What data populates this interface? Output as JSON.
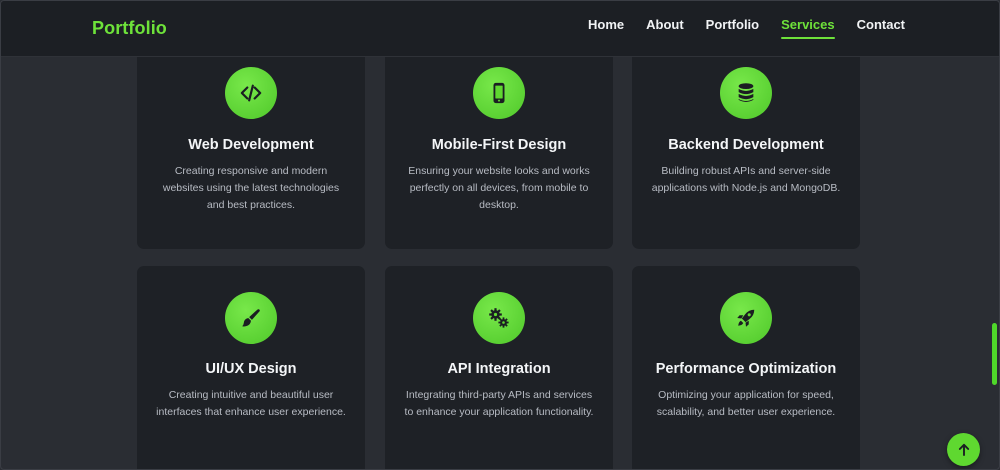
{
  "brand": {
    "name": "Portfolio"
  },
  "nav": {
    "items": [
      {
        "label": "Home"
      },
      {
        "label": "About"
      },
      {
        "label": "Portfolio"
      },
      {
        "label": "Services",
        "active": true
      },
      {
        "label": "Contact"
      }
    ]
  },
  "services": [
    {
      "icon": "code-icon",
      "title": "Web Development",
      "description": "Creating responsive and modern websites using the latest technologies and best practices."
    },
    {
      "icon": "mobile-icon",
      "title": "Mobile-First Design",
      "description": "Ensuring your website looks and works perfectly on all devices, from mobile to desktop."
    },
    {
      "icon": "database-icon",
      "title": "Backend Development",
      "description": "Building robust APIs and server-side applications with Node.js and MongoDB."
    },
    {
      "icon": "paintbrush-icon",
      "title": "UI/UX Design",
      "description": "Creating intuitive and beautiful user interfaces that enhance user experience."
    },
    {
      "icon": "gears-icon",
      "title": "API Integration",
      "description": "Integrating third-party APIs and services to enhance your application functionality."
    },
    {
      "icon": "rocket-icon",
      "title": "Performance Optimization",
      "description": "Optimizing your application for speed, scalability, and better user experience."
    }
  ],
  "colors": {
    "accent": "#6ee23a",
    "background": "#2a2d33",
    "card": "#1e2126",
    "navbar": "#1c1f24"
  },
  "scroll_to_top": {
    "icon": "arrow-up-icon"
  }
}
